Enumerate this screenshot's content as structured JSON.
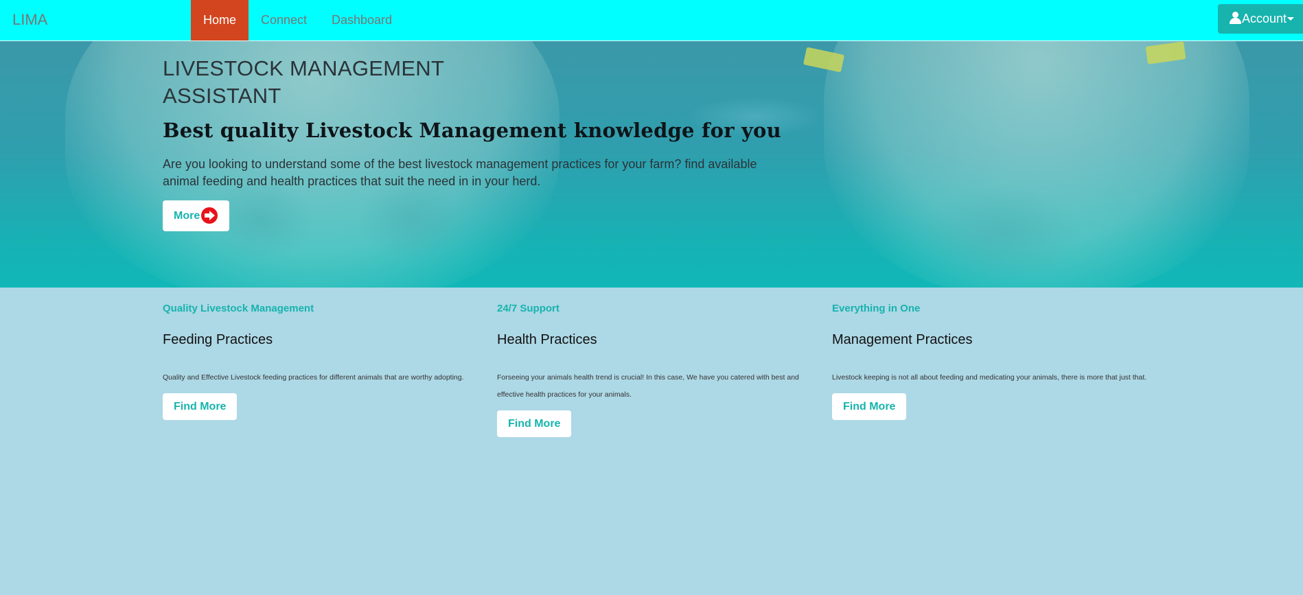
{
  "navbar": {
    "brand": "LIMA",
    "items": [
      {
        "label": "Home",
        "active": true
      },
      {
        "label": "Connect",
        "active": false
      },
      {
        "label": "Dashboard",
        "active": false
      }
    ],
    "account_label": "Account",
    "account_icon": "user-icon"
  },
  "hero": {
    "title": "LIVESTOCK MANAGEMENT ASSISTANT",
    "tagline": "Best quality Livestock Management knowledge for you",
    "description": "Are you looking to understand some of the best livestock management practices for your farm? find available animal feeding and health practices that suit the need in in your herd.",
    "more_label": "More",
    "more_icon": "arrow-right-circle-icon"
  },
  "features": [
    {
      "kicker": "Quality Livestock Management",
      "title": "Feeding Practices",
      "description": "Quality and Effective Livestock feeding practices for different animals that are worthy adopting.",
      "button_label": "Find More"
    },
    {
      "kicker": "24/7 Support",
      "title": "Health Practices",
      "description": "Forseeing your animals health trend is crucial! In this case, We have you catered with best and effective health practices for your animals.",
      "button_label": "Find More"
    },
    {
      "kicker": "Everything in One",
      "title": "Management Practices",
      "description": "Livestock keeping is not all about feeding and medicating your animals, there is more that just that.",
      "button_label": "Find More"
    }
  ],
  "colors": {
    "navbar_bg": "#00ffff",
    "active_nav": "#d2451e",
    "accent": "#17b3ad",
    "page_bg": "#add8e6",
    "more_icon": "#e8121a"
  }
}
